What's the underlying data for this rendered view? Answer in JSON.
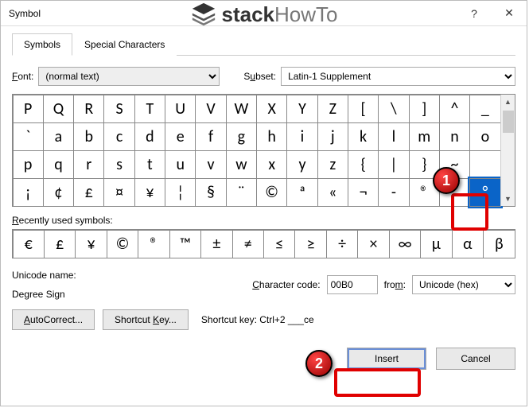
{
  "window": {
    "title": "Symbol",
    "help": "?",
    "close": "✕"
  },
  "logo": {
    "part1": "stack",
    "part2": "HowTo"
  },
  "tabs": {
    "symbols": "Symbols",
    "special": "Special Characters"
  },
  "fontRow": {
    "fontLabel_pre": "F",
    "fontLabel_post": "ont:",
    "fontValue": "(normal text)",
    "subsetLabel_pre": "S",
    "subsetLabel_u": "u",
    "subsetLabel_post": "bset:",
    "subsetValue": "Latin-1 Supplement"
  },
  "grid": [
    "P",
    "Q",
    "R",
    "S",
    "T",
    "U",
    "V",
    "W",
    "X",
    "Y",
    "Z",
    "[",
    "\\",
    "]",
    "^",
    "_",
    "`",
    "a",
    "b",
    "c",
    "d",
    "e",
    "f",
    "g",
    "h",
    "i",
    "j",
    "k",
    "l",
    "m",
    "n",
    "o",
    "p",
    "q",
    "r",
    "s",
    "t",
    "u",
    "v",
    "w",
    "x",
    "y",
    "z",
    "{",
    "|",
    "}",
    "~",
    "",
    "¡",
    "¢",
    "£",
    "¤",
    "¥",
    "¦",
    "§",
    "¨",
    "©",
    "ª",
    "«",
    "¬",
    "­-",
    "®",
    "¯",
    "°"
  ],
  "selectedIndex": 63,
  "recentLabel_pre": "R",
  "recentLabel_post": "ecently used symbols:",
  "recent": [
    "€",
    "£",
    "¥",
    "©",
    "®",
    "™",
    "±",
    "≠",
    "≤",
    "≥",
    "÷",
    "×",
    "∞",
    "μ",
    "α",
    "β"
  ],
  "unicode": {
    "nameLabel": "Unicode name:",
    "nameValue": "Degree Sign",
    "codeLabel_pre": "",
    "codeLabel_u": "C",
    "codeLabel_post": "haracter code:",
    "codeValue": "00B0",
    "fromLabel_pre": "fro",
    "fromLabel_u": "m",
    "fromLabel_post": ":",
    "fromValue": "Unicode (hex)"
  },
  "buttons": {
    "autocorrect_pre": "",
    "autocorrect_u": "A",
    "autocorrect_post": "utoCorrect...",
    "shortcut_pre": "Shortcut ",
    "shortcut_u": "K",
    "shortcut_post": "ey...",
    "shortcutInfo": "Shortcut key: Ctrl+2 ___ce",
    "insert": "Insert",
    "cancel": "Cancel"
  },
  "annotations": {
    "a1": "1",
    "a2": "2"
  }
}
